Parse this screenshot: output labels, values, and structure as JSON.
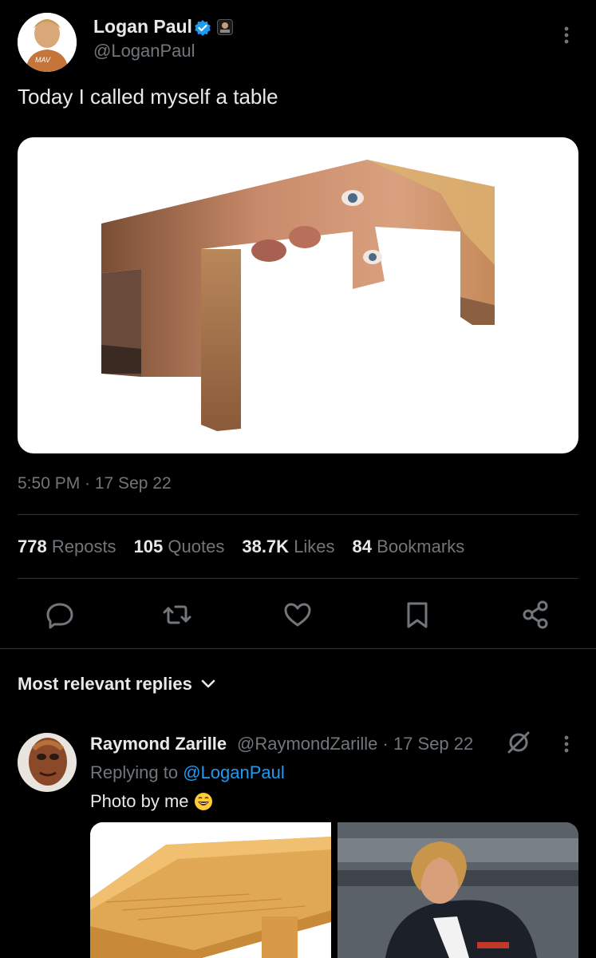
{
  "tweet": {
    "author_name": "Logan Paul",
    "author_handle": "@LoganPaul",
    "text": "Today I called myself a table",
    "timestamp": "5:50 PM · 17 Sep 22",
    "avatar_icon": "avatar-logan-paul",
    "verified_icon": "verified-badge-icon",
    "affiliate_icon": "affiliate-badge-icon",
    "media_icon": "table-face-image"
  },
  "stats": {
    "reposts_num": "778",
    "reposts_label": "Reposts",
    "quotes_num": "105",
    "quotes_label": "Quotes",
    "likes_num": "38.7K",
    "likes_label": "Likes",
    "bookmarks_num": "84",
    "bookmarks_label": "Bookmarks"
  },
  "actions": [
    "reply-icon",
    "repost-icon",
    "like-icon",
    "bookmark-icon",
    "share-icon"
  ],
  "replies_header": {
    "label": "Most relevant replies",
    "icon": "chevron-down-icon"
  },
  "reply": {
    "author_name": "Raymond Zarille",
    "meta": "@RaymondZarille · 17 Sep 22",
    "replying_prefix": "Replying to",
    "replying_mention": "@LoganPaul",
    "text": "Photo by me",
    "emoji_icon": "laughing-emoji-icon",
    "grok_icon": "grok-icon"
  },
  "colors": {
    "background": "#000000",
    "text_primary": "#e7e9ea",
    "text_secondary": "#71767b",
    "accent": "#1d9bf0",
    "divider": "#2f3336"
  }
}
